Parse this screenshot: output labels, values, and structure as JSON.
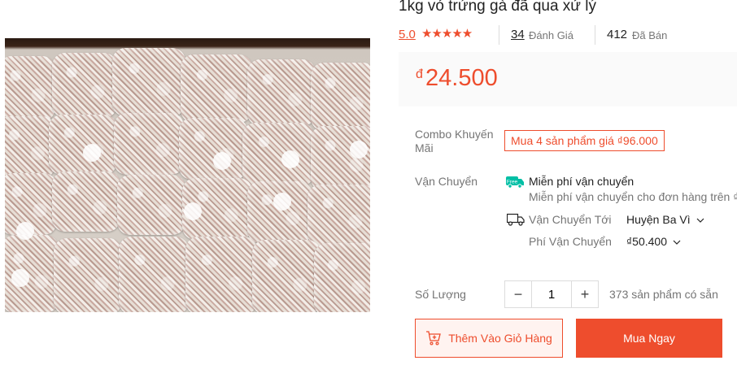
{
  "product": {
    "title": "1kg vỏ trứng gà đã qua xử lý",
    "rating": "5.0",
    "stars": "★★★★★",
    "review_count": "34",
    "review_label": "Đánh Giá",
    "sold_count": "412",
    "sold_label": "Đã Bán",
    "currency": "đ",
    "price": "24.500",
    "image_icon": "product-photo-egg-shell-bags"
  },
  "promo": {
    "label": "Combo Khuyến Mãi",
    "tag": "Mua 4 sản phẩm giá ₫96.000"
  },
  "shipping": {
    "label": "Vận Chuyển",
    "free_badge": "Free",
    "free_title": "Miễn phí vận chuyển",
    "free_desc": "Miễn phí vận chuyển cho đơn hàng trên ₫",
    "to_label": "Vận Chuyển Tới",
    "to_value": "Huyện Ba Vì",
    "fee_label": "Phí Vận Chuyển",
    "fee_value": "₫50.400"
  },
  "quantity": {
    "label": "Số Lượng",
    "minus": "−",
    "value": "1",
    "plus": "+",
    "stock": "373 sản phẩm có sẵn"
  },
  "actions": {
    "add_to_cart": "Thêm Vào Giỏ Hàng",
    "buy_now": "Mua Ngay"
  },
  "colors": {
    "accent": "#ee4d2d",
    "free_ship": "#00bfa5"
  }
}
